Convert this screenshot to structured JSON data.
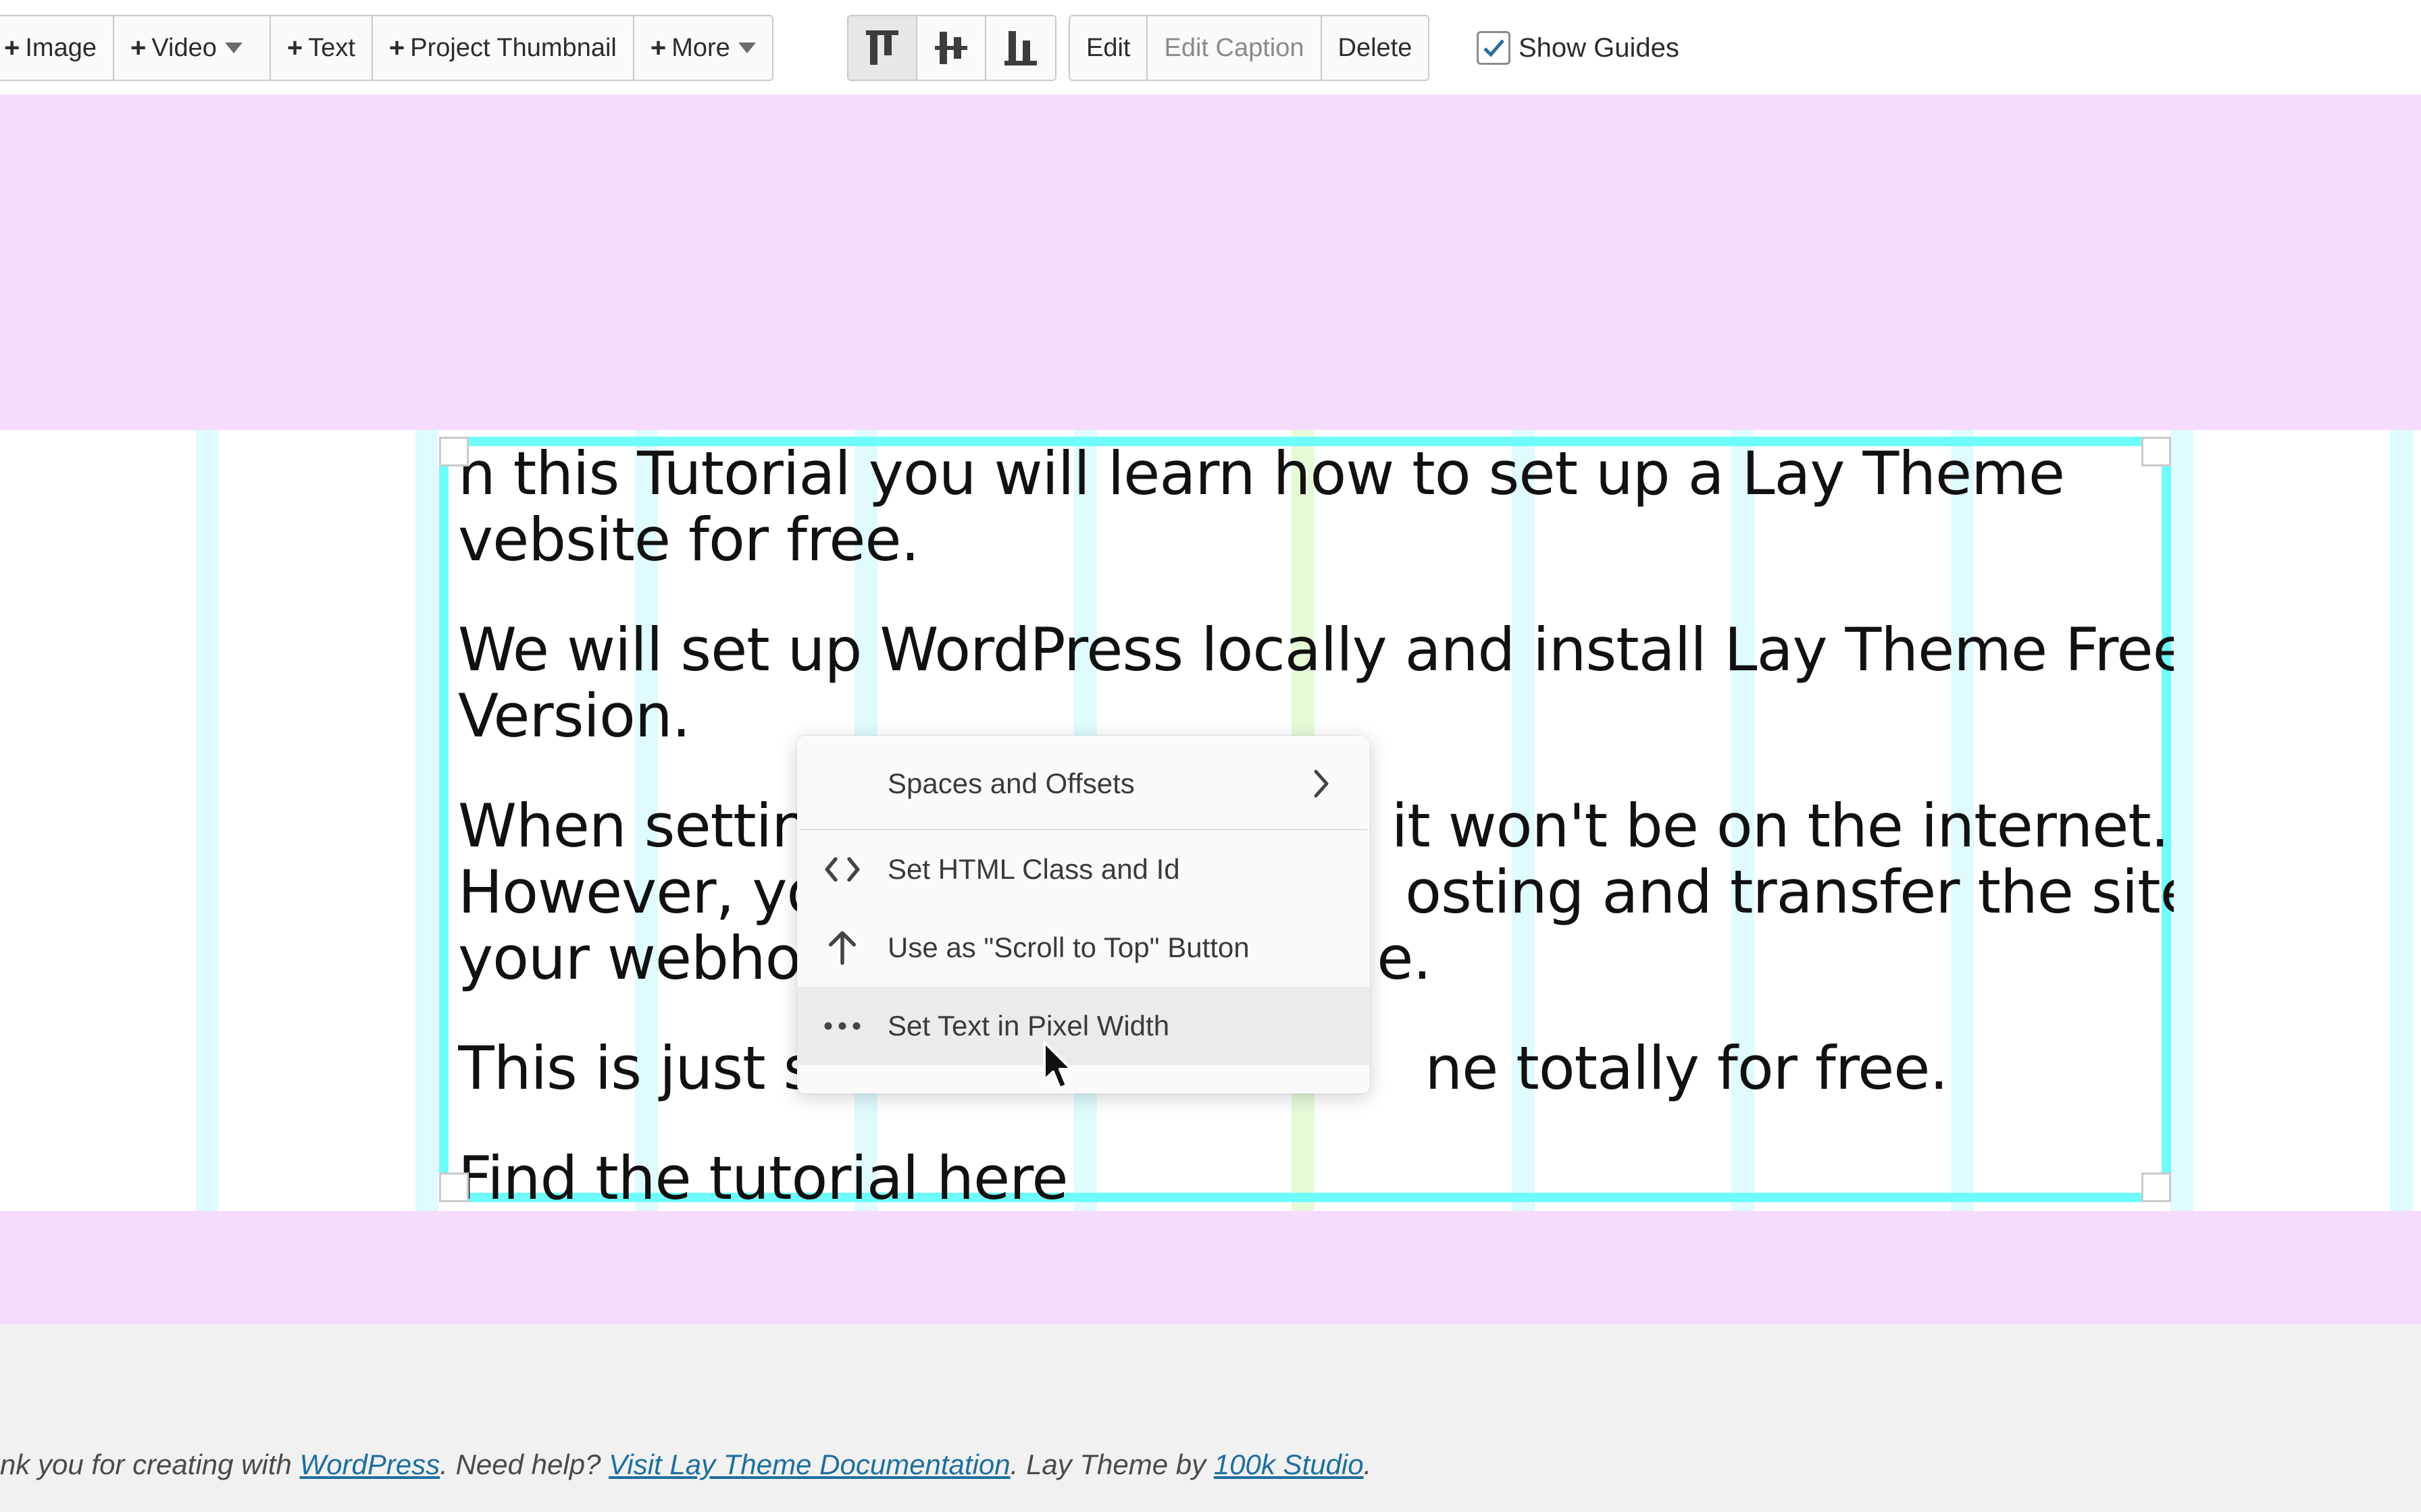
{
  "toolbar": {
    "image_label": "Image",
    "video_label": "Video",
    "text_label": "Text",
    "project_thumbnail_label": "Project Thumbnail",
    "more_label": "More",
    "edit_label": "Edit",
    "edit_caption_label": "Edit Caption",
    "delete_label": "Delete",
    "show_guides_label": "Show Guides",
    "show_guides_checked": true,
    "active_alignment": "top"
  },
  "content": {
    "paragraphs": [
      "n this Tutorial you will learn how to set up a Lay Theme",
      "vebsite for free.",
      "We will set up WordPress locally and install Lay Theme Free",
      "Version.",
      "When setting",
      "it won't be on the internet.",
      "However, you",
      "osting and transfer the site to",
      "your webhos",
      "e.",
      "This is just so",
      "ne totally for free.",
      "Find the tutorial here"
    ]
  },
  "context_menu": {
    "items": [
      {
        "label": "Spaces and Offsets",
        "icon": "chevron-right-icon"
      },
      {
        "label": "Set HTML Class and Id",
        "icon": "code-icon"
      },
      {
        "label": "Use as \"Scroll to Top\" Button",
        "icon": "arrow-up-icon"
      },
      {
        "label": "Set Text in Pixel Width",
        "icon": "more-horizontal-icon"
      }
    ]
  },
  "footer": {
    "prefix": "nk you for creating with ",
    "wordpress_link": "WordPress",
    "middle": ". Need help? ",
    "docs_link": "Visit Lay Theme Documentation",
    "middle2": ". Lay Theme by ",
    "studio_link": "100k Studio",
    "suffix": "."
  },
  "colors": {
    "selection_border": "#6ffbfb",
    "row_background": "#f6dcfc",
    "guide": "#dffbfe",
    "link": "#1e6f9e"
  }
}
